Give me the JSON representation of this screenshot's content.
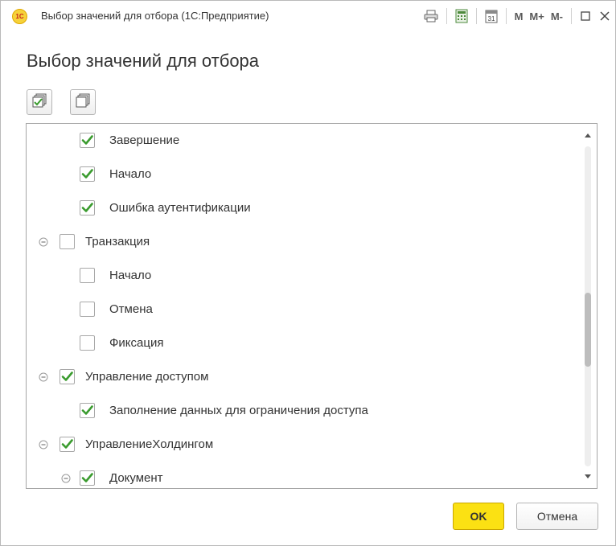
{
  "window": {
    "title": "Выбор значений для отбора  (1С:Предприятие)",
    "app_logo_text": "1С",
    "memory_buttons": [
      "M",
      "M+",
      "M-"
    ]
  },
  "dialog": {
    "header": "Выбор значений для отбора"
  },
  "tree": {
    "rows": [
      {
        "label": "Завершение",
        "level": 1,
        "checked": true,
        "has_toggle": false
      },
      {
        "label": "Начало",
        "level": 1,
        "checked": true,
        "has_toggle": false
      },
      {
        "label": "Ошибка аутентификации",
        "level": 1,
        "checked": true,
        "has_toggle": false
      },
      {
        "label": "Транзакция",
        "level": 0,
        "checked": false,
        "has_toggle": true
      },
      {
        "label": "Начало",
        "level": 1,
        "checked": false,
        "has_toggle": false
      },
      {
        "label": "Отмена",
        "level": 1,
        "checked": false,
        "has_toggle": false
      },
      {
        "label": "Фиксация",
        "level": 1,
        "checked": false,
        "has_toggle": false
      },
      {
        "label": "Управление доступом",
        "level": 0,
        "checked": true,
        "has_toggle": true
      },
      {
        "label": "Заполнение данных для ограничения доступа",
        "level": 1,
        "checked": true,
        "has_toggle": false
      },
      {
        "label": "УправлениеХолдингом",
        "level": 0,
        "checked": true,
        "has_toggle": true
      },
      {
        "label": "Документ",
        "level": 1,
        "checked": true,
        "has_toggle": true
      }
    ]
  },
  "buttons": {
    "ok": "OK",
    "cancel": "Отмена"
  },
  "colors": {
    "check_mark": "#3a9b2e",
    "ok_button": "#fbe113",
    "panel_border": "#a6a6a6"
  }
}
